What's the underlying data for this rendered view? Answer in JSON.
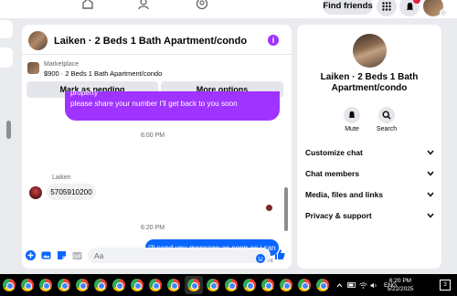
{
  "topnav": {
    "find_friends": "Find friends"
  },
  "chat": {
    "title": "Laiken · 2 Beds 1 Bath Apartment/condo",
    "marketplace_label": "Marketplace",
    "listing": "$900 · 2 Beds 1 Bath Apartment/condo",
    "pending_button": "Mark as pending",
    "more_button": "More options",
    "messages": {
      "purple_line1": "property",
      "purple_line2": "please share your number I'll get back to you soon",
      "time1": "6:00 PM",
      "sender": "Laiken",
      "phone": "5705910200",
      "time2": "6:20 PM",
      "reply": "i'll send you message as soon as i can",
      "status": "Sent"
    },
    "composer_placeholder": "Aa"
  },
  "info_panel": {
    "title": "Laiken · 2 Beds 1 Bath Apartment/condo",
    "mute": "Mute",
    "search": "Search",
    "sections": [
      "Customize chat",
      "Chat members",
      "Media, files and links",
      "Privacy & support"
    ]
  },
  "taskbar": {
    "language": "ENG",
    "time": "6:20 PM",
    "date": "5/22/2025",
    "notifications": "3"
  },
  "colors": {
    "accent_purple": "#a033ff",
    "messenger_blue": "#0866ff",
    "notification_red": "#e41e3f"
  }
}
